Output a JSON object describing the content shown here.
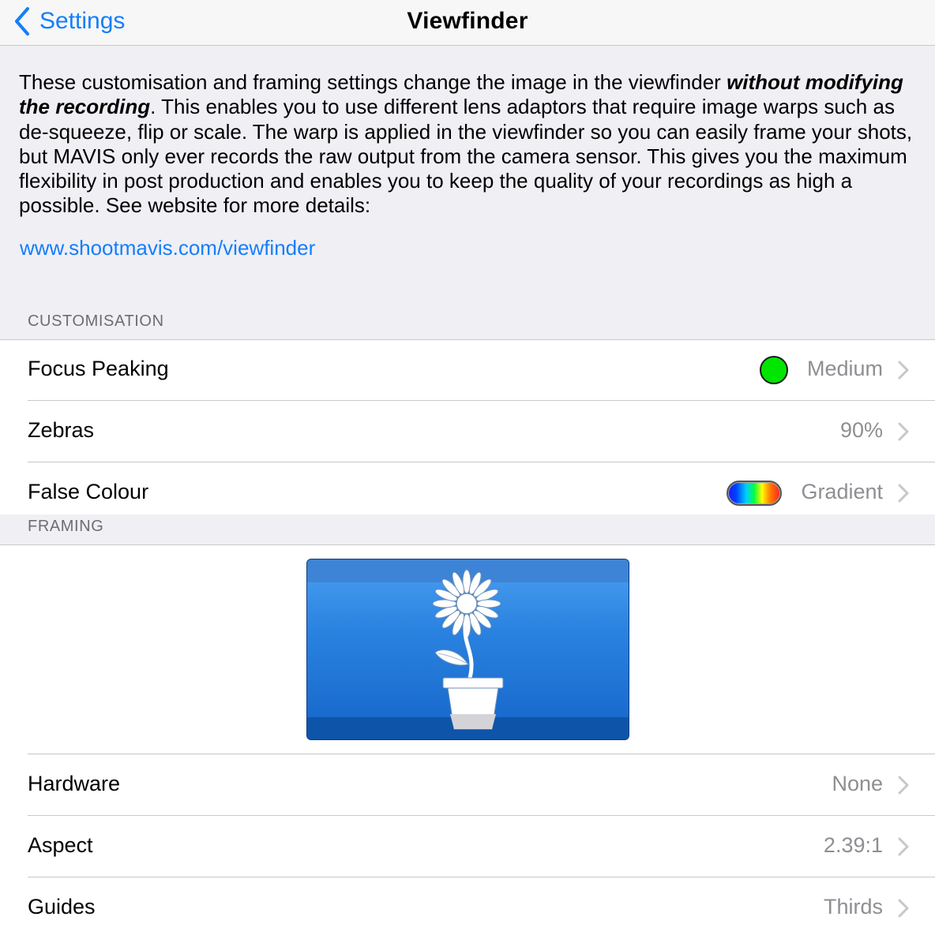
{
  "nav": {
    "back_label": "Settings",
    "title": "Viewfinder"
  },
  "description": {
    "before": "These customisation and framing settings change the image in the viewfinder ",
    "emphasis": "without modifying the recording",
    "after": ". This enables you to use different lens adaptors that require image warps such as de-squeeze, flip or scale. The warp is applied in the viewfinder so you can easily frame your shots, but MAVIS only ever records the raw output from the camera sensor. This gives you the maximum flexibility in post production and enables you to keep the quality of your recordings as high a possible. See website for more details:",
    "link": "www.shootmavis.com/viewfinder"
  },
  "customisation": {
    "header": "CUSTOMISATION",
    "rows": [
      {
        "label": "Focus Peaking",
        "value": "Medium",
        "swatch": "#00e600"
      },
      {
        "label": "Zebras",
        "value": "90%"
      },
      {
        "label": "False Colour",
        "value": "Gradient"
      }
    ]
  },
  "framing": {
    "header": "FRAMING",
    "preview_icon": "flower-pot-icon",
    "rows": [
      {
        "label": "Hardware",
        "value": "None"
      },
      {
        "label": "Aspect",
        "value": "2.39:1"
      },
      {
        "label": "Guides",
        "value": "Thirds"
      }
    ]
  },
  "colors": {
    "accent": "#157efb",
    "secondary_text": "#8e8e93",
    "background": "#efeff4"
  }
}
